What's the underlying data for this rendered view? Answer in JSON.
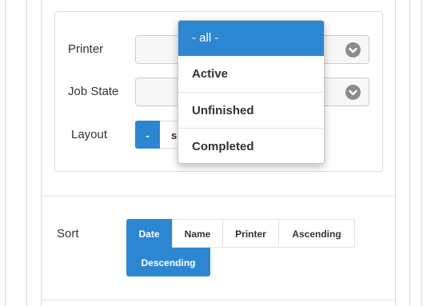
{
  "filters": {
    "printer_label": "Printer",
    "job_state_label": "Job State",
    "layout_label": "Layout",
    "layout_options": [
      "-",
      "s"
    ]
  },
  "dropdown": {
    "options": [
      "- all -",
      "Active",
      "Unfinished",
      "Completed"
    ],
    "selected": "- all -"
  },
  "sort": {
    "label": "Sort",
    "options": [
      "Date",
      "Name",
      "Printer",
      "Ascending",
      "Descending"
    ],
    "active": [
      "Date",
      "Descending"
    ]
  },
  "colors": {
    "accent": "#2d86d2"
  },
  "icons": {
    "select_arrow": "chevron-down-circle-icon"
  }
}
